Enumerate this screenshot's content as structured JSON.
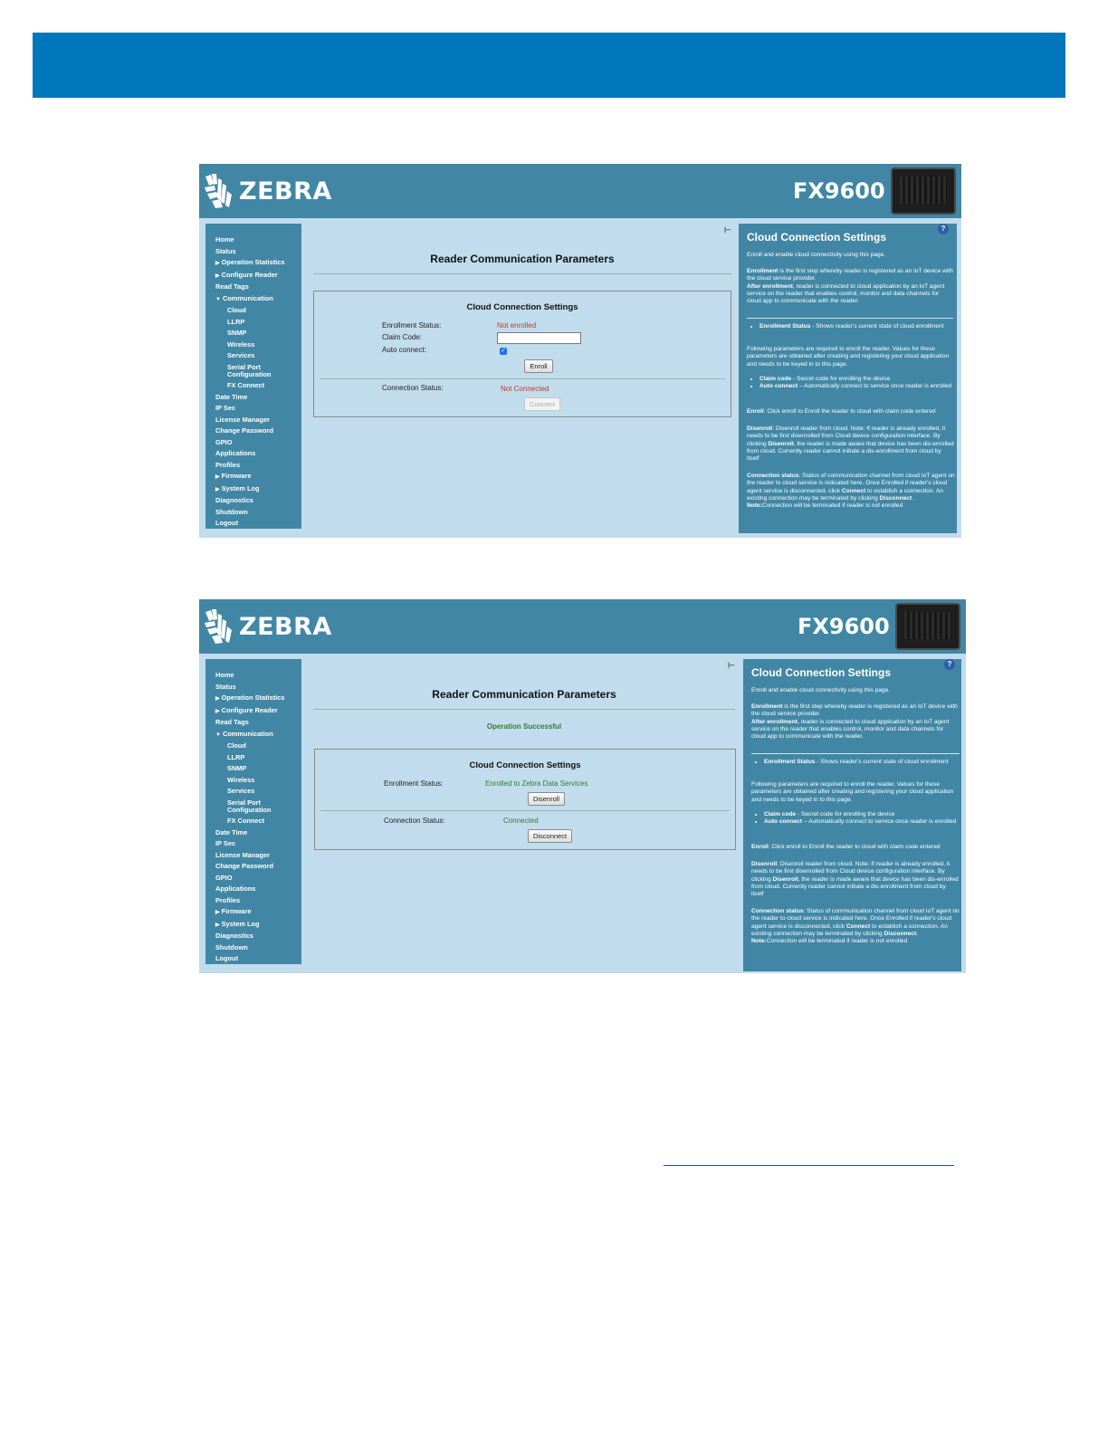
{
  "colors": {
    "banner": "#0076bb",
    "header": "#4187a5",
    "content_bg": "#c1dcec",
    "status_error": "#c0392b",
    "status_ok": "#2f7d32"
  },
  "brand": {
    "logo_text": "ZEBRA",
    "logo_icon": "zebra-head-icon",
    "model": "FX9600"
  },
  "nav_items": [
    "Home",
    "Status",
    "Operation Statistics",
    "Configure Reader",
    "Read Tags",
    "Communication",
    "Cloud",
    "LLRP",
    "SNMP",
    "Wireless",
    "Services",
    "Serial Port",
    "Configuration",
    "FX Connect",
    "Date Time",
    "IP Sec",
    "License Manager",
    "Change Password",
    "GPIO",
    "Applications",
    "Profiles",
    "Firmware",
    "System Log",
    "Diagnostics",
    "Shutdown",
    "Logout"
  ],
  "page": {
    "title": "Reader Communication Parameters",
    "pin_glyph": "⊢",
    "settings_title": "Cloud Connection Settings",
    "enrollment_label": "Enrollment Status:",
    "claim_code_label": "Claim Code:",
    "auto_connect_label": "Auto connect:",
    "connection_label": "Connection Status:"
  },
  "screen1": {
    "enrollment_status": "Not enrolled",
    "claim_code_value": "",
    "auto_connect_checked": true,
    "enroll_button": "Enroll",
    "connection_status": "Not Connected",
    "connect_button": "Connect"
  },
  "screen2": {
    "operation_message": "Operation Successful",
    "enrollment_status": "Enrolled to Zebra Data Services",
    "disenroll_button": "Disenroll",
    "connection_status": "Connected",
    "disconnect_button": "Disconnect"
  },
  "help": {
    "title": "Cloud Connection Settings",
    "question_glyph": "?",
    "intro": "Enroll and enable cloud connectivity using this page.",
    "enrollment_b": "Enrollment",
    "enrollment_text": " is the first step whereby reader is registered as an IoT device with the cloud service provider.",
    "after_b": "After enrollment",
    "after_text": ", reader is connected to cloud application by an IoT agent service on the reader that enables control, monitor and data channels for cloud app to communicate with the reader.",
    "status_b": "Enrollment Status",
    "status_text": " - Shows reader's current state of cloud enrollment",
    "params_text": "Following parameters are required to enroll the reader. Values for these parameters are obtained after creating and registering your cloud application and needs to be keyed in to this page.",
    "claim_b": "Claim code",
    "claim_text": " - Secret code for enrolling the device",
    "auto_b": "Auto connect",
    "auto_text": " – Automatically connect to service once reader is enrolled",
    "enroll_b": "Enroll",
    "enroll_text": ": Click enroll to Enroll the reader to cloud with claim code entered",
    "disenroll_b": "Disenroll",
    "disenroll_text": ": Disenroll reader from cloud. Note: If reader is already enrolled, it needs to be first disenrolled from Cloud device configuration interface. By clicking ",
    "disenroll_b2": "Disenroll",
    "disenroll_text2": ", the reader is made aware that device has been dis-enrolled from cloud. Currently reader cannot initiate a dis-enrollment from cloud by itself",
    "conn_b": "Connection status",
    "conn_text": ": Status of communication channel from cloud IoT agent on the reader to cloud service is indicated here. Once Enrolled if reader's cloud agent service is disconnected, click ",
    "conn_b2": "Connect",
    "conn_text2": " to establish a connection. An existing connection may be terminated by clicking ",
    "conn_b3": "Disconnect",
    "conn_text3": ".",
    "note_b": "Note:",
    "note_text": "Connection will be terminated if reader is not enrolled"
  }
}
